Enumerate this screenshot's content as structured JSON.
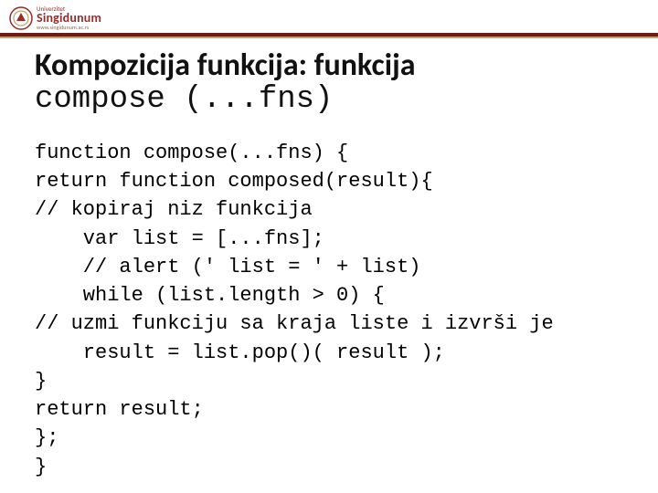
{
  "header": {
    "logo": {
      "top_small": "Univerzitet",
      "name": "Singidunum",
      "url": "www.singidunum.ac.rs"
    }
  },
  "title": {
    "line1": "Kompozicija funkcija: funkcija",
    "line2_mono": "compose (...fns)"
  },
  "code": {
    "l1": "function compose(...fns) {",
    "l2": "return function composed(result){",
    "l3": "// kopiraj niz funkcija",
    "l4": "    var list = [...fns];",
    "l5": "    // alert (' list = ' + list)",
    "l6": "    while (list.length > 0) {",
    "l7": "// uzmi funkciju sa kraja liste i izvrši je",
    "l8": "    result = list.pop()( result );",
    "l9": "}",
    "l10": "return result;",
    "l11": "};",
    "l12": "}"
  }
}
